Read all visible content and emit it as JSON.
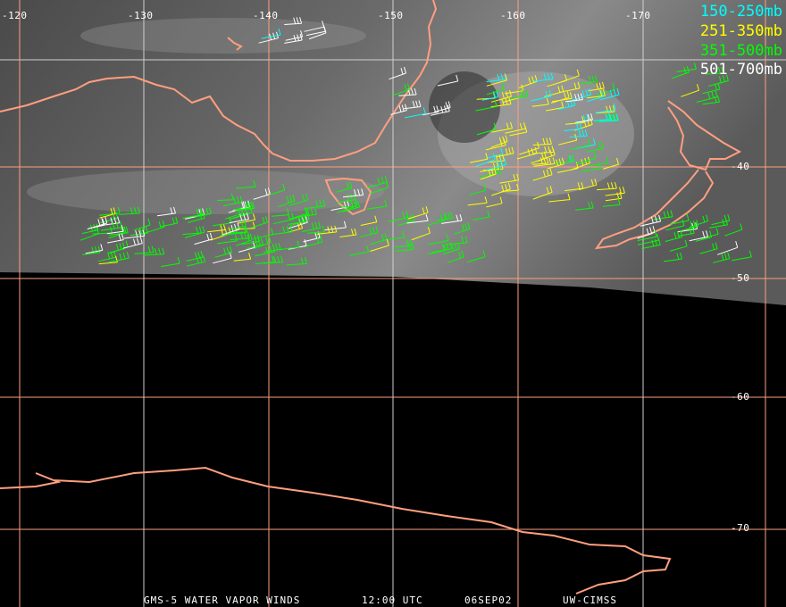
{
  "longitude_labels": [
    "-120",
    "-130",
    "-140",
    "-150",
    "-160",
    "-170"
  ],
  "latitude_labels": [
    "-40",
    "-50",
    "-60",
    "-70"
  ],
  "legend": [
    {
      "label": "150-250mb",
      "color": "#00ffff"
    },
    {
      "label": "251-350mb",
      "color": "#ffff00"
    },
    {
      "label": "351-500mb",
      "color": "#00ff00"
    },
    {
      "label": "501-700mb",
      "color": "#ffffff"
    }
  ],
  "footer": {
    "product": "GMS-5 WATER VAPOR WINDS",
    "time": "12:00 UTC",
    "date": "06SEP02",
    "source": "UW-CIMSS"
  },
  "colors": {
    "coastline": "#ff9f7f",
    "grid_orange": "#ff9f7f",
    "grid_white": "#d0d0d0"
  }
}
